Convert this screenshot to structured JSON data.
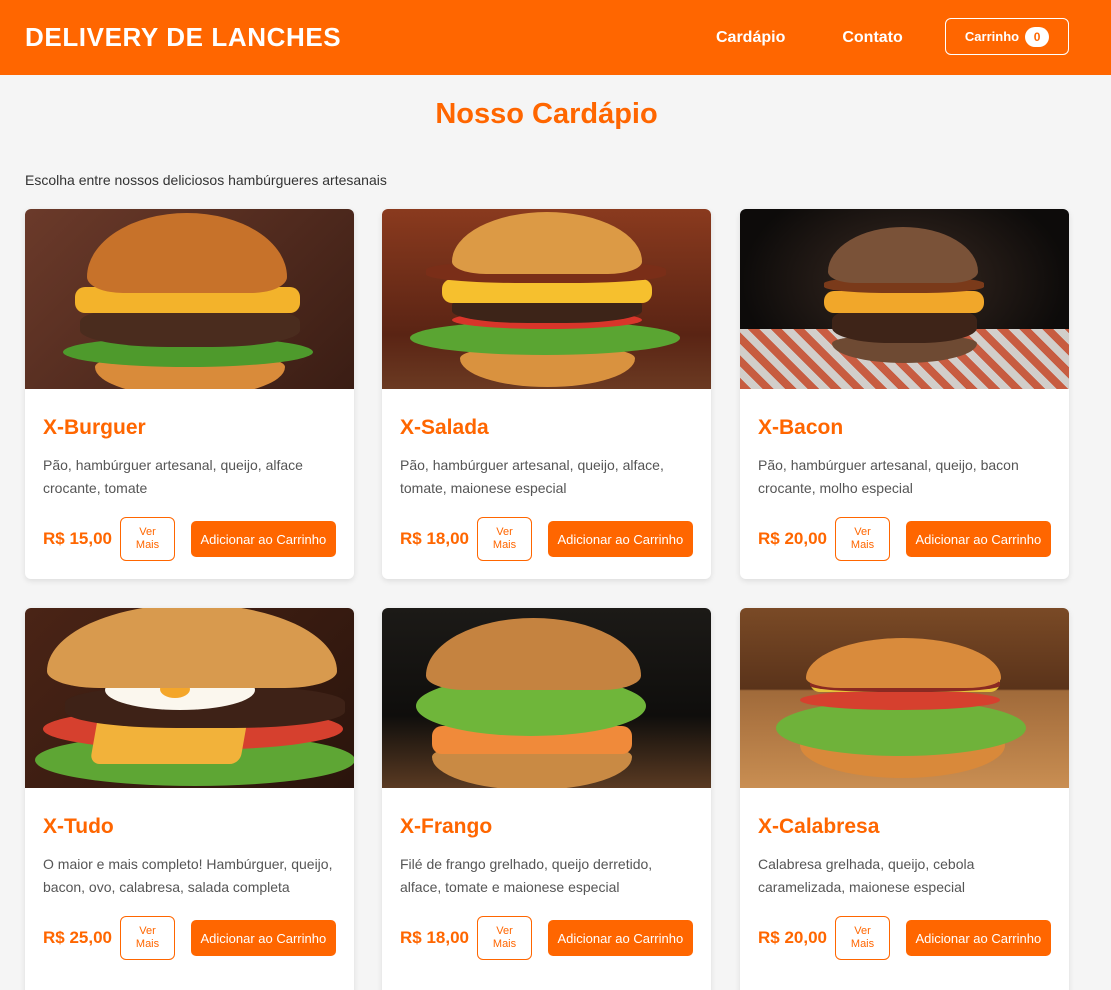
{
  "header": {
    "brand": "DELIVERY DE LANCHES",
    "nav": [
      {
        "label": "Cardápio"
      },
      {
        "label": "Contato"
      }
    ],
    "cart_label": "Carrinho",
    "cart_count": "0"
  },
  "main": {
    "title": "Nosso Cardápio",
    "subtitle": "Escolha entre nossos deliciosos hambúrgueres artesanais"
  },
  "colors": {
    "accent": "#ff6600",
    "background": "#f5f5f5"
  },
  "products": [
    {
      "name": "X-Burguer",
      "desc": "Pão, hambúrguer artesanal, queijo, alface crocante, tomate",
      "price": "R$ 15,00",
      "more": "Ver Mais",
      "add": "Adicionar ao Carrinho"
    },
    {
      "name": "X-Salada",
      "desc": "Pão, hambúrguer artesanal, queijo, alface, tomate, maionese especial",
      "price": "R$ 18,00",
      "more": "Ver Mais",
      "add": "Adicionar ao Carrinho"
    },
    {
      "name": "X-Bacon",
      "desc": "Pão, hambúrguer artesanal, queijo, bacon crocante, molho especial",
      "price": "R$ 20,00",
      "more": "Ver Mais",
      "add": "Adicionar ao Carrinho"
    },
    {
      "name": "X-Tudo",
      "desc": "O maior e mais completo! Hambúrguer, queijo, bacon, ovo, calabresa, salada completa",
      "price": "R$ 25,00",
      "more": "Ver Mais",
      "add": "Adicionar ao Carrinho"
    },
    {
      "name": "X-Frango",
      "desc": "Filé de frango grelhado, queijo derretido, alface, tomate e maionese especial",
      "price": "R$ 18,00",
      "more": "Ver Mais",
      "add": "Adicionar ao Carrinho"
    },
    {
      "name": "X-Calabresa",
      "desc": "Calabresa grelhada, queijo, cebola caramelizada, maionese especial",
      "price": "R$ 20,00",
      "more": "Ver Mais",
      "add": "Adicionar ao Carrinho"
    }
  ]
}
